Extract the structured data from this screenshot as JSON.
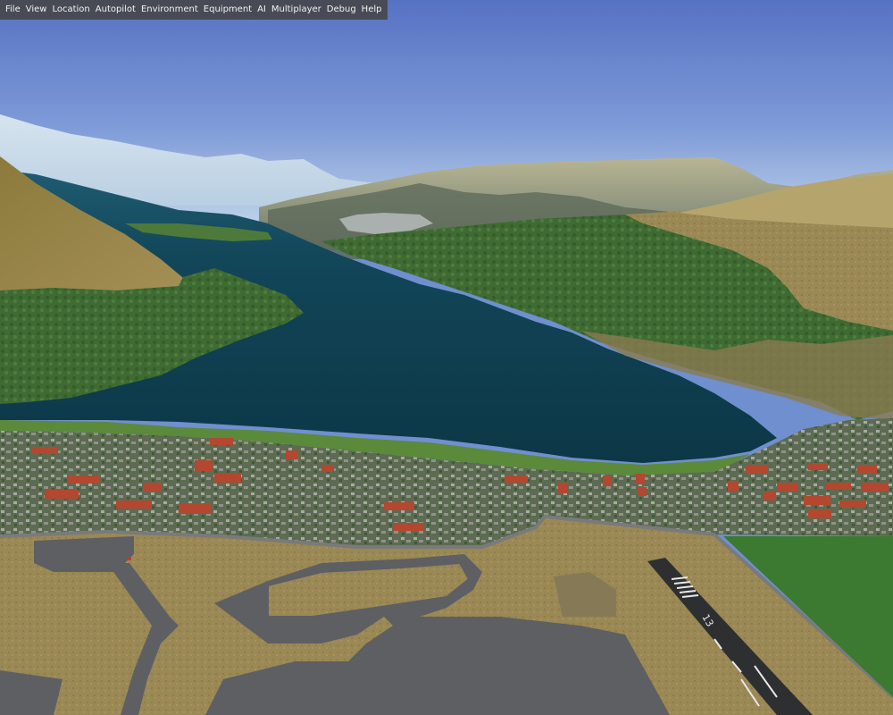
{
  "menubar": {
    "items": [
      {
        "label": "File"
      },
      {
        "label": "View"
      },
      {
        "label": "Location"
      },
      {
        "label": "Autopilot"
      },
      {
        "label": "Environment"
      },
      {
        "label": "Equipment"
      },
      {
        "label": "AI"
      },
      {
        "label": "Multiplayer"
      },
      {
        "label": "Debug"
      },
      {
        "label": "Help"
      }
    ]
  },
  "scene": {
    "type": "flight-simulator-3d-view",
    "description_colors": {
      "sky_top": "#5b78c6",
      "sky_horizon": "#b7cde8",
      "lake": "#0f3c4c",
      "forest": "#3e6a30",
      "dry_grass": "#a08c57",
      "asphalt": "#5e5f63",
      "runway": "#2e2f31",
      "roof_red": "#b4472f"
    },
    "runway_number": "13"
  }
}
